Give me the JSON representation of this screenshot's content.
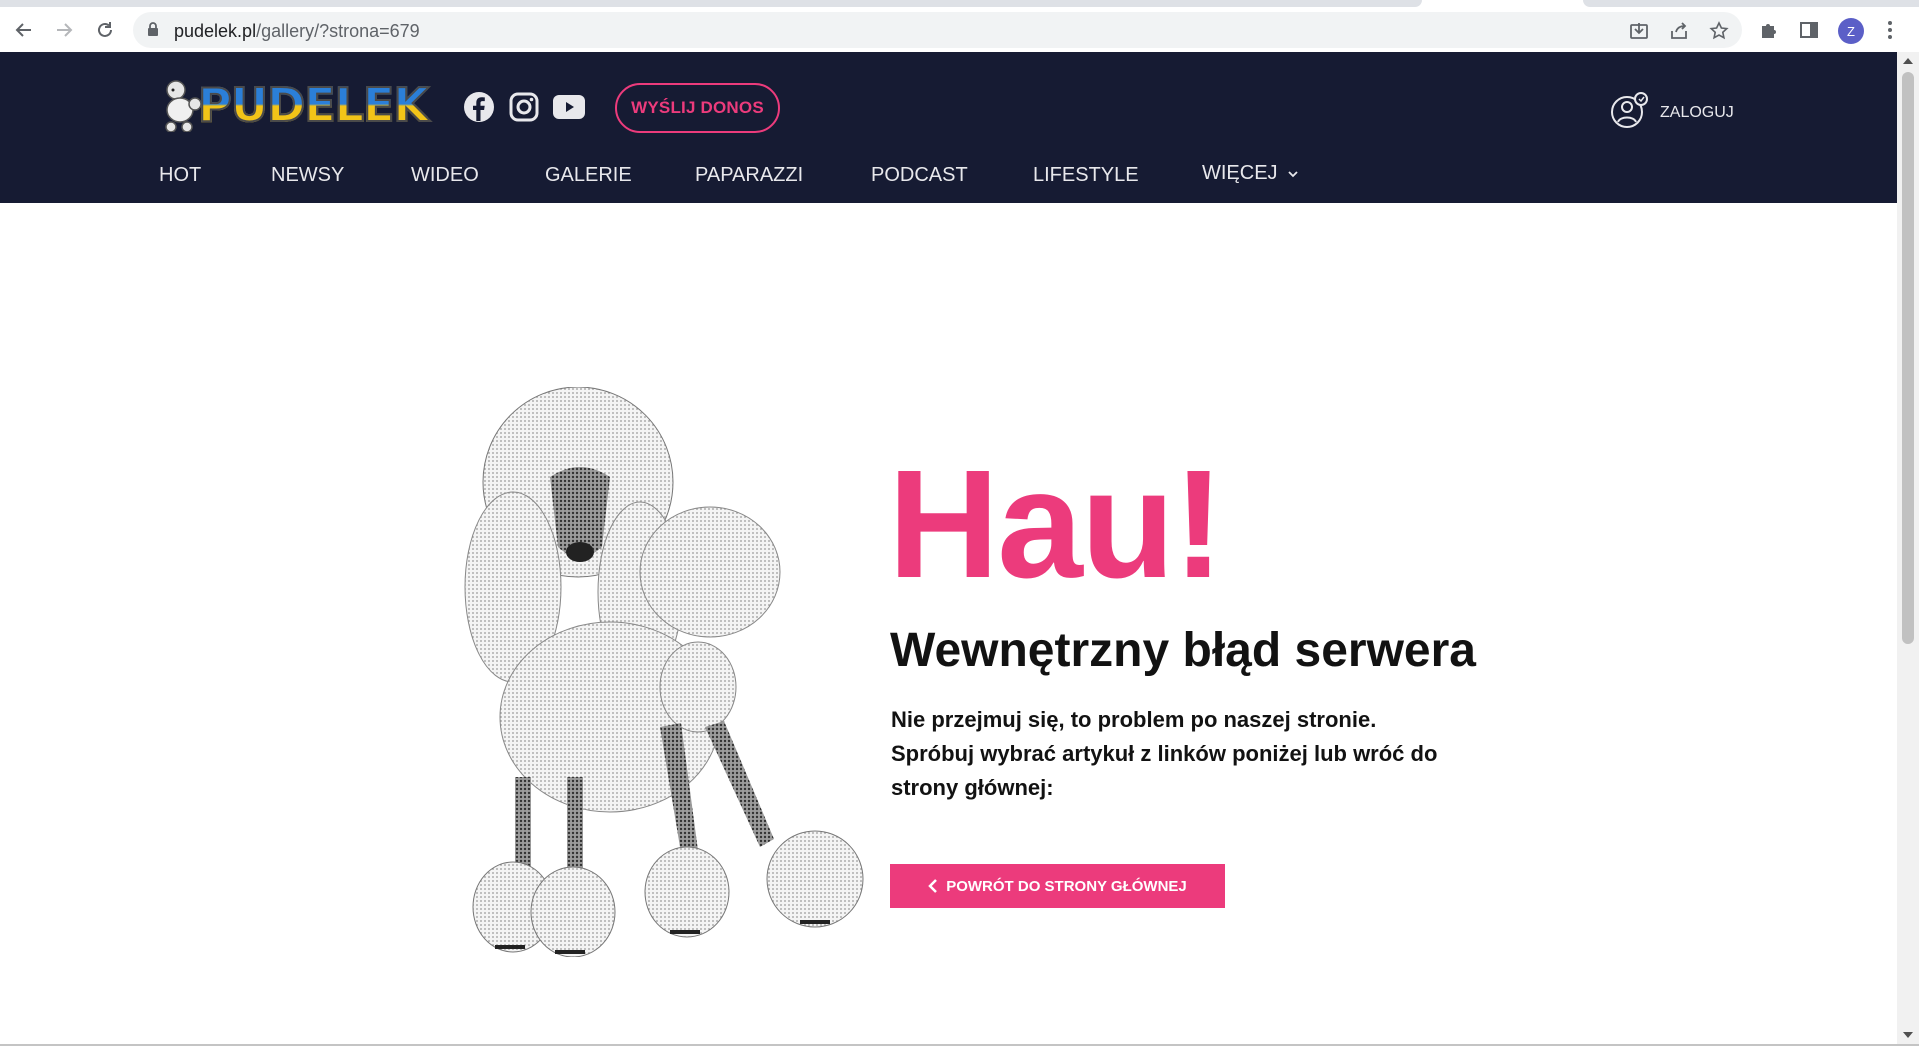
{
  "browser": {
    "url_domain": "pudelek.pl",
    "url_path": "/gallery/?strona=679",
    "profile_initial": "Z"
  },
  "header": {
    "logo_text": "PUDELEK",
    "donos_button": "WYŚLIJ DONOS",
    "login_label": "ZALOGUJ",
    "nav": [
      "HOT",
      "NEWSY",
      "WIDEO",
      "GALERIE",
      "PAPARAZZI",
      "PODCAST",
      "LIFESTYLE",
      "WIĘCEJ"
    ]
  },
  "error": {
    "heading": "Hau!",
    "title": "Wewnętrzny błąd serwera",
    "message": "Nie przejmuj się, to problem po naszej stronie. Spróbuj wybrać artykuł z linków poniżej lub wróć do strony głównej:",
    "home_button": "POWRÓT DO STRONY GŁÓWNEJ"
  },
  "colors": {
    "header_bg": "#161b33",
    "accent": "#ec3b7c",
    "text": "#121212"
  }
}
